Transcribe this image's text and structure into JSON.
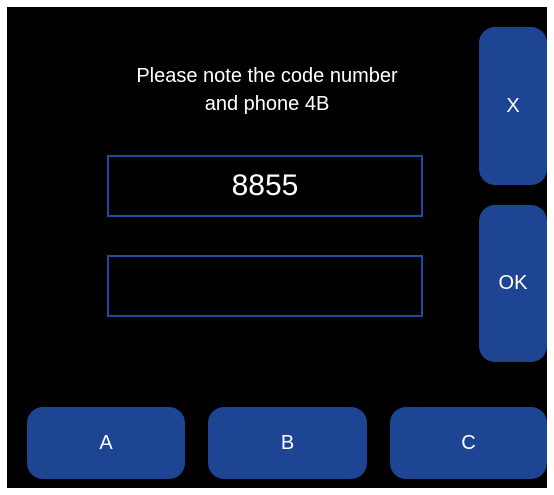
{
  "dialog": {
    "message_line1": "Please note the code number",
    "message_line2": "and phone 4B",
    "code_value": "8855",
    "input_value": ""
  },
  "buttons": {
    "close_label": "X",
    "ok_label": "OK",
    "a_label": "A",
    "b_label": "B",
    "c_label": "C"
  },
  "colors": {
    "background": "#000000",
    "button": "#1d4593",
    "field_border": "#1f4aa3",
    "text": "#ffffff"
  }
}
